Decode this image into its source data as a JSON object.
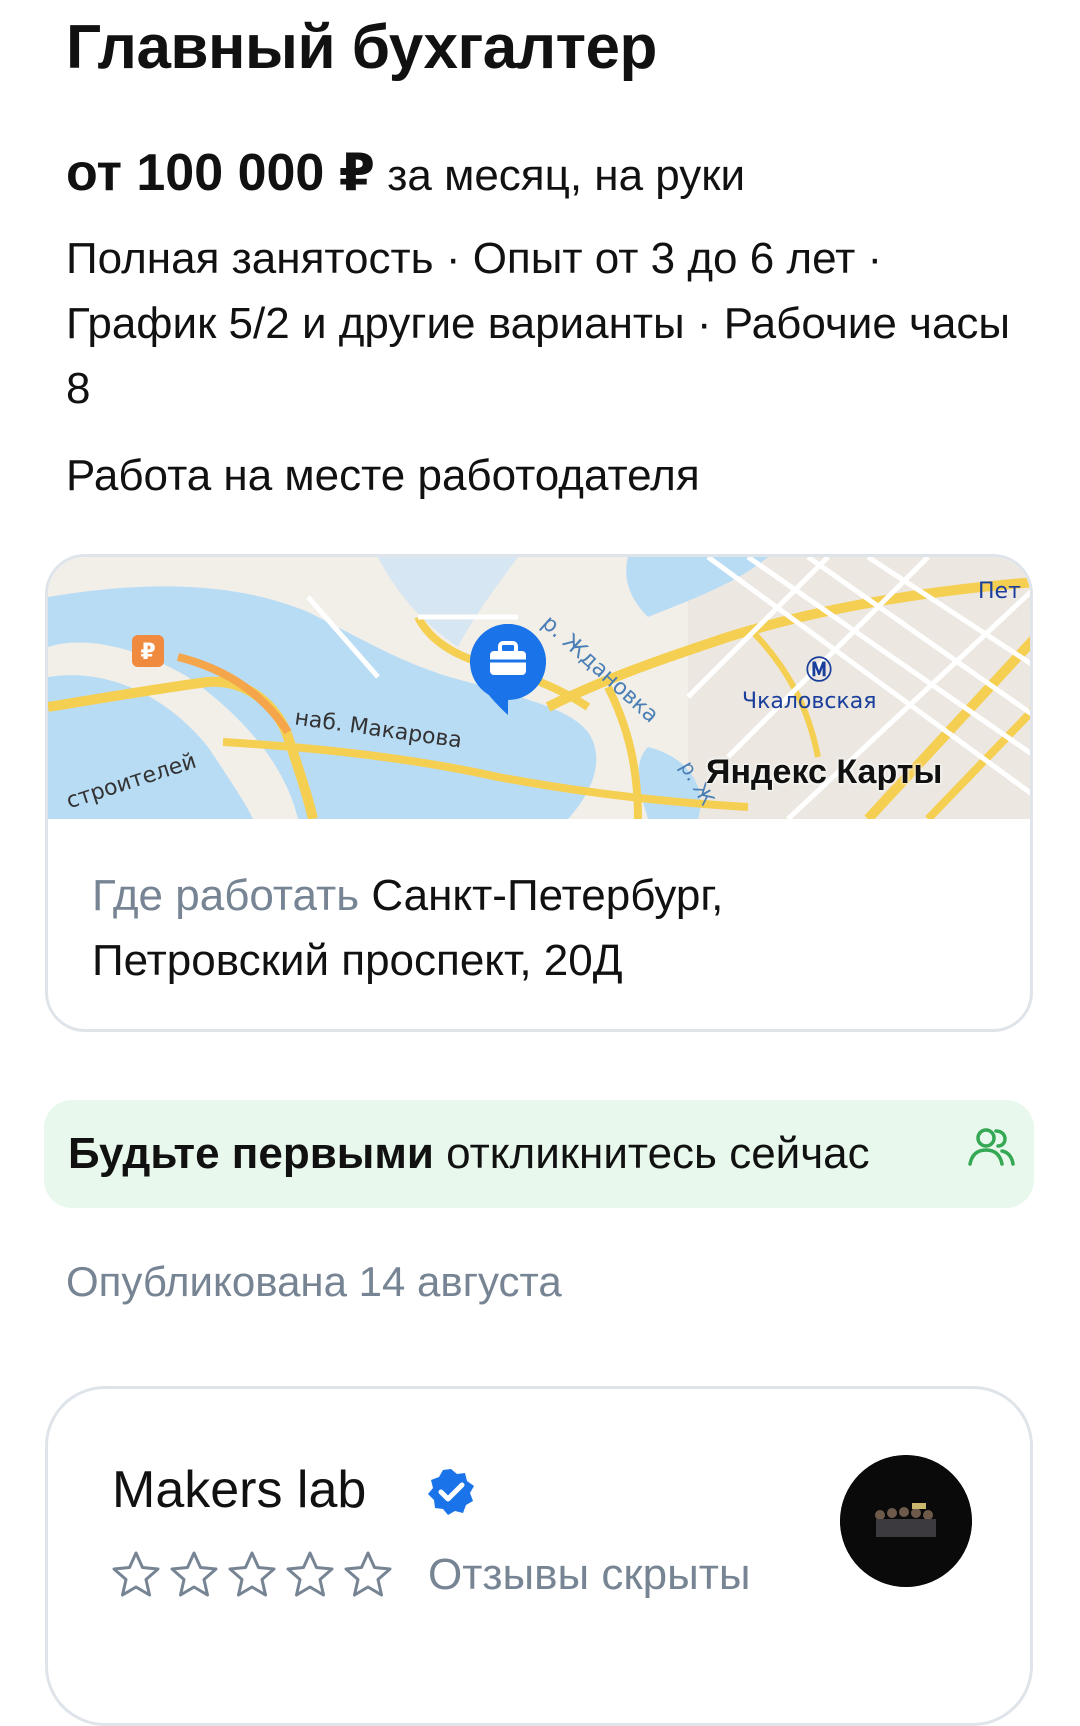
{
  "vacancy": {
    "title": "Главный бухгалтер",
    "salary_amount": "от 100 000 ₽",
    "salary_suffix": " за месяц, на руки",
    "conditions": "Полная занятость · Опыт от 3 до 6 лет · График 5/2 и другие варианты · Рабочие часы 8",
    "work_type": "Работа на месте работодателя"
  },
  "map": {
    "provider_logo_text": "Яндекс Карты",
    "labels": {
      "street_makarova": "наб. Макарова",
      "river_zhdanovka": "р. Ждановка",
      "metro_station": "Чкаловская",
      "street_stroiteley": "строителей",
      "corner_label": "Пет",
      "river_stub": "р. Ж"
    },
    "icons": [
      "briefcase-pin-icon",
      "ruble-marker-icon",
      "metro-icon"
    ]
  },
  "address": {
    "label": "Где работать",
    "value": " Санкт-Петербург, Петровский проспект, 20Д"
  },
  "banner": {
    "strong": "Будьте первыми",
    "text": " откликнитесь сейчас",
    "icon": "people-icon"
  },
  "published": "Опубликована 14 августа",
  "company": {
    "name": "Makers lab",
    "verified_icon": "verified-badge-icon",
    "rating_stars": 0,
    "rating_max": 5,
    "reviews_text": "Отзывы скрыты"
  },
  "colors": {
    "text": "#111111",
    "muted": "#768494",
    "card_border": "#dfe4ea",
    "banner_bg": "#e8f8ec",
    "accent_blue": "#1a73e8",
    "map_water": "#b9dcf5",
    "map_road": "#f5cf52"
  }
}
